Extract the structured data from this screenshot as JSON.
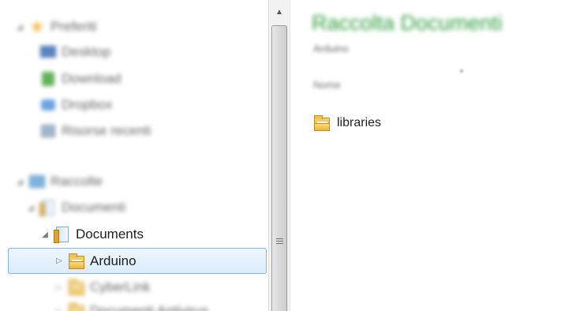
{
  "nav": {
    "favorites": {
      "label": "Preferiti"
    },
    "favorites_items": [
      {
        "label": "Desktop"
      },
      {
        "label": "Download"
      },
      {
        "label": "Dropbox"
      },
      {
        "label": "Risorse recenti"
      }
    ],
    "libraries": {
      "label": "Raccolte"
    },
    "documents_library": {
      "label": "Documenti"
    },
    "documents": {
      "label": "Documents"
    },
    "selected_folder": {
      "label": "Arduino"
    },
    "subfolders": [
      {
        "label": "CyberLink"
      },
      {
        "label": "Documenti Antivirus"
      }
    ]
  },
  "content": {
    "library_title": "Raccolta Documenti",
    "library_subtitle": "Arduino",
    "column_name": "Nome",
    "files": [
      {
        "label": "libraries"
      }
    ]
  },
  "icons": {
    "arrow_expanded": "◢",
    "arrow_collapsed": "▷",
    "scroll_up": "▲"
  },
  "colors": {
    "selection_border": "#7eb4ea",
    "selection_fill": "#dcecfc",
    "title_green": "#2f9e3e",
    "folder_yellow": "#e6ad2e"
  }
}
